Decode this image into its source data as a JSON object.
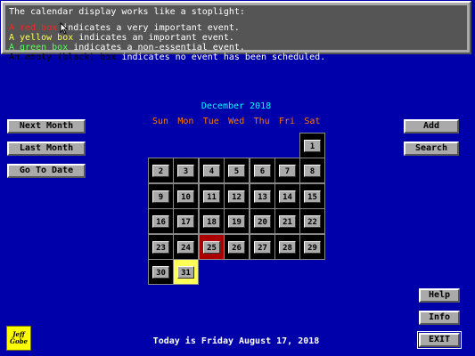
{
  "info": {
    "title": "The calendar display works like a stoplight:",
    "lines": [
      {
        "swatch": "A red box",
        "text": " indicates a very important event.",
        "color": "#ff2222"
      },
      {
        "swatch": "A yellow box",
        "text": " indicates an important event.",
        "color": "#ffff55"
      },
      {
        "swatch": "A green box",
        "text": " indicates a non-essential event.",
        "color": "#55ff55"
      },
      {
        "swatch": "An empty (black) box",
        "text": " indicates no event has been scheduled.",
        "color": "#000000"
      }
    ]
  },
  "calendar": {
    "title": "December 2018",
    "weekdays": [
      "Sun",
      "Mon",
      "Tue",
      "Wed",
      "Thu",
      "Fri",
      "Sat"
    ],
    "first_weekday": 6,
    "days": [
      "1",
      "2",
      "3",
      "4",
      "5",
      "6",
      "7",
      "8",
      "9",
      "10",
      "11",
      "12",
      "13",
      "14",
      "15",
      "16",
      "17",
      "18",
      "19",
      "20",
      "21",
      "22",
      "23",
      "24",
      "25",
      "26",
      "27",
      "28",
      "29",
      "30",
      "31"
    ],
    "highlights": {
      "25": "red",
      "31": "yellow"
    }
  },
  "left_buttons": [
    "Next Month",
    "Last Month",
    "Go To Date"
  ],
  "right_buttons": [
    "Add",
    "Search"
  ],
  "bottom_buttons": [
    "Help",
    "Info",
    "EXIT"
  ],
  "footer": {
    "today": "Today is Friday August 17, 2018",
    "logo_line1": "Jeff",
    "logo_line2": "Gobe"
  },
  "colors": {
    "background": "#0000aa",
    "month_title": "#00ffff",
    "weekday": "#ff7700",
    "red_box": "#aa0000",
    "yellow_box": "#ffff55"
  }
}
